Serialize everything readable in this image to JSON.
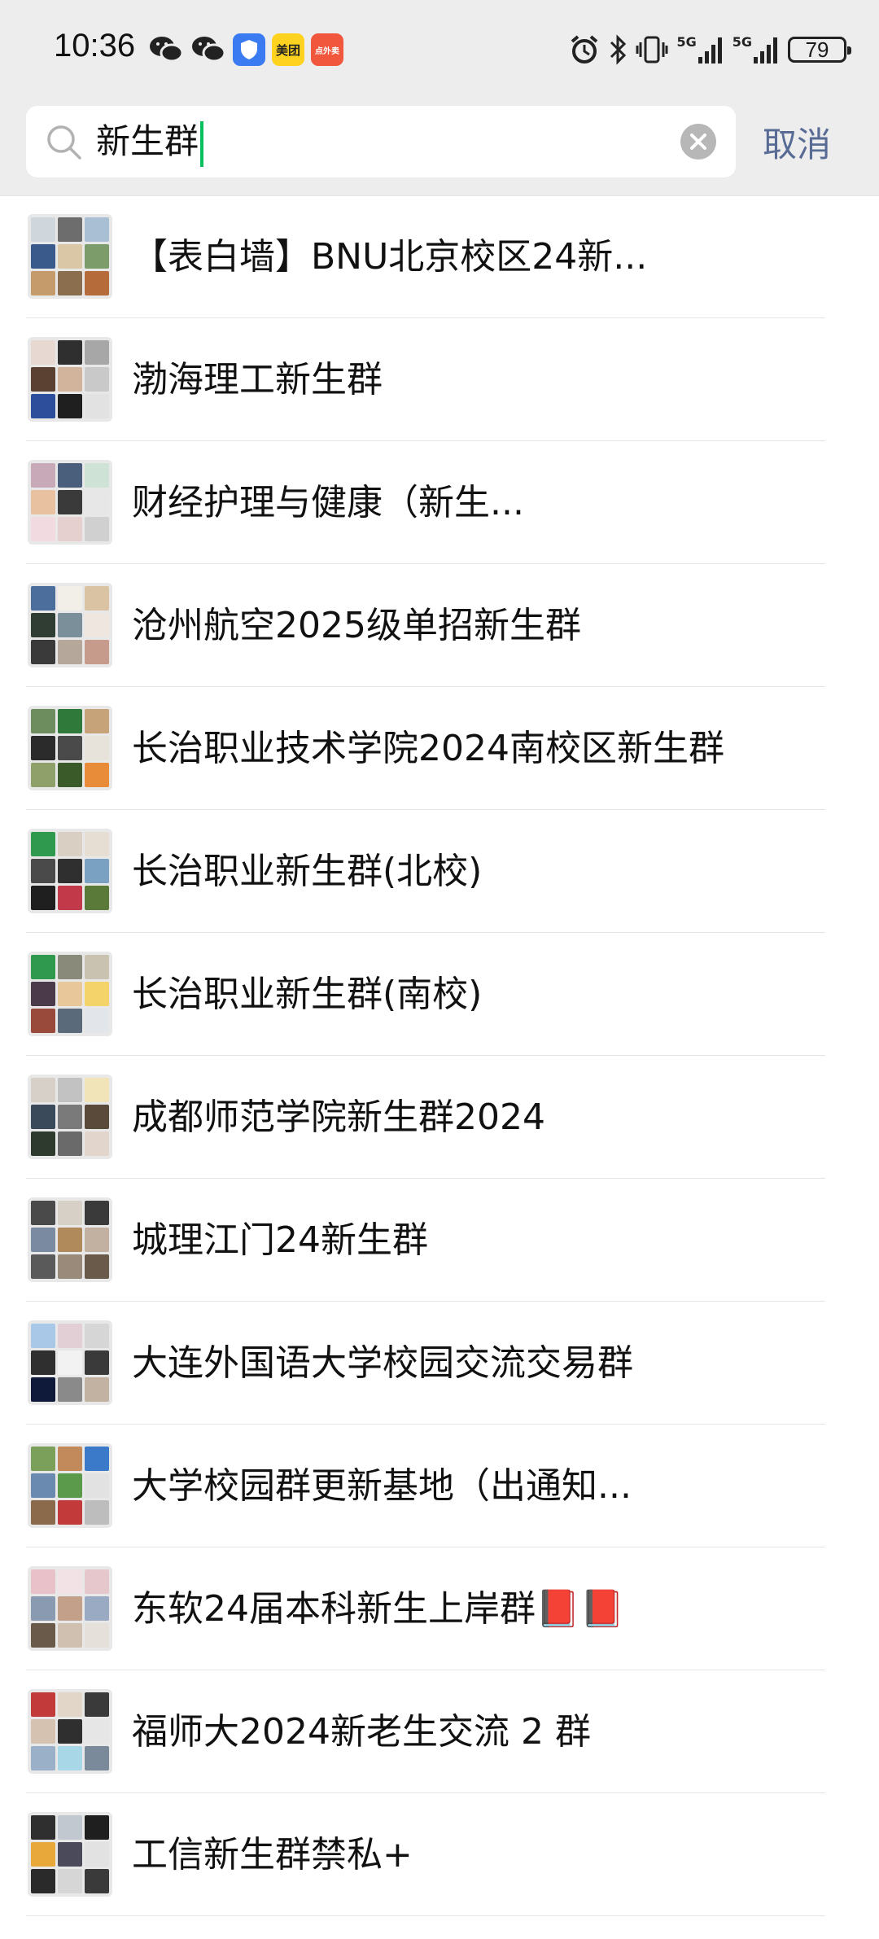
{
  "status_bar": {
    "time": "10:36",
    "app_icons": [
      "wechat-icon",
      "wechat-icon",
      "security-app-icon",
      "meituan-app-icon",
      "dianwaimai-app-icon"
    ],
    "meituan_label": "美团",
    "dianwaimai_label": "点外卖",
    "signal_1": "5G",
    "signal_2": "5G",
    "battery": "79"
  },
  "search": {
    "query": "新生群",
    "cancel_label": "取消"
  },
  "results": [
    {
      "title": "【表白墙】BNU北京校区24新...",
      "tiles": [
        "#cfd6dc",
        "#6d6d6d",
        "#a9bfd3",
        "#3b5a8c",
        "#d9c7a5",
        "#7c9d6a",
        "#c59b6b",
        "#8a6e4d",
        "#b56b3a"
      ]
    },
    {
      "title": "渤海理工新生群",
      "tiles": [
        "#e7d9d2",
        "#2f2f2f",
        "#a7a7a7",
        "#5a4132",
        "#d2b39b",
        "#c9c9c9",
        "#2d4e9a",
        "#1f1f1f",
        "#e2e2e2"
      ]
    },
    {
      "title": "财经护理与健康（新生...",
      "tiles": [
        "#c7a9b8",
        "#4a5f7c",
        "#cfe2d6",
        "#e8c1a0",
        "#3a3a3a",
        "#e7e7e7",
        "#f1dbe0",
        "#e6cfcf",
        "#d0d0d0"
      ]
    },
    {
      "title": "沧州航空2025级单招新生群",
      "tiles": [
        "#4b6e9c",
        "#f2efe9",
        "#d9c3a2",
        "#2f3d33",
        "#7a8f9a",
        "#efe7df",
        "#3a3a3a",
        "#b5a89a",
        "#c79b8c"
      ]
    },
    {
      "title": "长治职业技术学院2024南校区新生群",
      "tiles": [
        "#6d8d5e",
        "#2f7a3a",
        "#c7a37a",
        "#2b2b2b",
        "#4a4a4a",
        "#e7e2da",
        "#8fa06a",
        "#3a5a2a",
        "#e98c3a"
      ]
    },
    {
      "title": "长治职业新生群(北校)",
      "tiles": [
        "#2f9a4e",
        "#d9cfc2",
        "#e6ded3",
        "#4a4a4a",
        "#2f2f2f",
        "#7aa0c2",
        "#1f1f1f",
        "#c23a4a",
        "#5a7a3a"
      ]
    },
    {
      "title": "长治职业新生群(南校)",
      "tiles": [
        "#2f9a4e",
        "#8a8a7a",
        "#c9c2b0",
        "#4a3a4a",
        "#e8c89a",
        "#f3d36a",
        "#9a4a3a",
        "#5a6a7a",
        "#e2e6ea"
      ]
    },
    {
      "title": "成都师范学院新生群2024",
      "tiles": [
        "#d6d0c8",
        "#c2c2c2",
        "#f0e4b8",
        "#3a4a5a",
        "#7a7a7a",
        "#5a4a3a",
        "#2f3a2f",
        "#6a6a6a",
        "#e2d6cc"
      ]
    },
    {
      "title": "城理江门24新生群",
      "tiles": [
        "#4a4a4a",
        "#d6d0c6",
        "#3a3a3a",
        "#7a8aa0",
        "#b08a5a",
        "#c2b0a0",
        "#5a5a5a",
        "#9a8a7a",
        "#6a5a4a"
      ]
    },
    {
      "title": "大连外国语大学校园交流交易群",
      "tiles": [
        "#a9c8e8",
        "#e2cfd6",
        "#d6d6d6",
        "#2f2f2f",
        "#f2f2f2",
        "#3a3a3a",
        "#0f1a3a",
        "#8a8a8a",
        "#c2b2a2"
      ]
    },
    {
      "title": "大学校园群更新基地（出通知...",
      "tiles": [
        "#7aa05a",
        "#c28a5a",
        "#3a7ac8",
        "#6a8ab0",
        "#5a9a4a",
        "#e2e2e2",
        "#8a6a4a",
        "#c23a3a",
        "#bdbdbd"
      ]
    },
    {
      "title": "东软24届本科新生上岸群📕📕",
      "tiles": [
        "#e8c2c8",
        "#f2e2e6",
        "#e6c8cc",
        "#8a9ab0",
        "#c2a08a",
        "#9aaac2",
        "#6a5a4a",
        "#d0c0b0",
        "#e6e0da"
      ]
    },
    {
      "title": "福师大2024新老生交流 2 群",
      "tiles": [
        "#c23a3a",
        "#e2d6c8",
        "#3a3a3a",
        "#d6c2b0",
        "#2f2f2f",
        "#e6e6e6",
        "#9ab0c8",
        "#a8d8e8",
        "#7a8a9a"
      ]
    },
    {
      "title": "工信新生群禁私+",
      "tiles": [
        "#2f2f2f",
        "#c2c8d0",
        "#1f1f1f",
        "#e8a83a",
        "#4a4a5a",
        "#e2e2e2",
        "#2a2a2a",
        "#d6d6d6",
        "#3a3a3a"
      ]
    }
  ]
}
